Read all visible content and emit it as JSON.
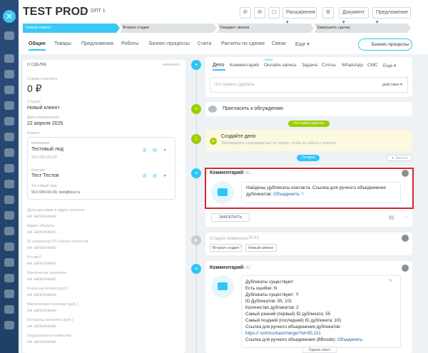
{
  "header": {
    "title": "TEST PROD",
    "tag": "ОПТ 1",
    "ext_btn": "Расширения",
    "doc_btn": "Документ",
    "offer_btn": "Предложение"
  },
  "stages": [
    "Новый клиент",
    "Вторая стадия",
    "Ожидает звонка",
    "Завершить сделку"
  ],
  "tabs": [
    "Общие",
    "Товары",
    "Предложения",
    "Роботы",
    "Бизнес-процессы",
    "Счета",
    "Расчеты по сделке",
    "Связи",
    "Еще"
  ],
  "bp_button": "Бизнес-процессы",
  "left": {
    "section": "О СДЕЛКЕ",
    "edit": "изменить",
    "sum_label": "Сумма и валюта",
    "sum_value": "0 ₽",
    "stage_label": "Стадия",
    "stage_value": "Новый клиент",
    "date_label": "Дата завершения",
    "date_value": "22 апреля 2025",
    "client_label": "Клиент",
    "company_label": "Компания",
    "company_name": "Тестовый лид",
    "company_phone": "910 000-00-00",
    "contact_label": "Контакт",
    "contact_name": "Тест Тестов",
    "lead_label": "Тестовый лид",
    "lead_info": "910 000-00-00, test@test.ru",
    "fields": [
      {
        "label": "День доставки в адрес клиента",
        "value": "не заполнено"
      },
      {
        "label": "Адрес объекта",
        "value": "не заполнено"
      },
      {
        "label": "ID элемента СП Список объектов",
        "value": "не заполнено"
      },
      {
        "label": "Кто вы?",
        "value": "не заполнено"
      },
      {
        "label": "Фактически оплачено",
        "value": "не заполнено"
      },
      {
        "label": "Счета на оплату (руб.)",
        "value": "не заполнено"
      },
      {
        "label": "Фактические платежи (руб.)",
        "value": "не заполнено"
      },
      {
        "label": "Осталось оплатить (руб.)",
        "value": "не заполнено"
      },
      {
        "label": "Трудозатраты в минутах",
        "value": "не заполнено"
      }
    ]
  },
  "timeline": {
    "new_badge": "новое",
    "tabs": [
      "Дело",
      "Комментарий",
      "Онлайн-запись",
      "Задача",
      "Слоты",
      "WhatsApp",
      "СМС",
      "Еще"
    ],
    "todo_placeholder": "Что нужно сделать",
    "actions": "действия",
    "invite": "Пригласить к обсуждению",
    "todo_badge": "Что нужно сделать",
    "create_title": "Создайте дело",
    "create_sub": "Запланируйте следующий шаг по сделке, чтобы не забыть о клиенте",
    "filter": "фильтр",
    "today": "Сегодня",
    "c1_title": "Комментарий",
    "c1_time": "20:41",
    "c1_text": "Найдены дубликаты контакта. Ссылка для ручного объединения дубликатов:",
    "c1_link": "Объединить",
    "pin": "ЗАКРЕПИТЬ",
    "stage_title": "Стадия изменена",
    "stage_time": "20:41",
    "stage_from": "Вторая стадия",
    "stage_to": "Новый клиент",
    "c2_title": "Комментарий",
    "c2_time": "20:41",
    "c2_lines": [
      "Дубликаты существуют:",
      "Есть ошибки: N",
      "Дубликаты существуют: Y",
      "ID Дубликатов: 55, 101",
      "Количество дубликатов: 2",
      "Самый ранний (первый) ID дубликата: 55",
      "Самый поздний (последний) ID дубликата: 101",
      "Ссылка для ручного объединения дубликатов:"
    ],
    "c2_url": "https://              /crm/contact/merge/?id=55,101",
    "c2_last": "Ссылка для ручного объединения (BBcode):",
    "c2_last_link": "Объединить",
    "hide": "Скрыть текст"
  },
  "colors": {
    "accent": "#2fc6f6",
    "stage_active": "#3bc8f5",
    "green": "#9dcf00",
    "highlight": "#d9232e"
  }
}
